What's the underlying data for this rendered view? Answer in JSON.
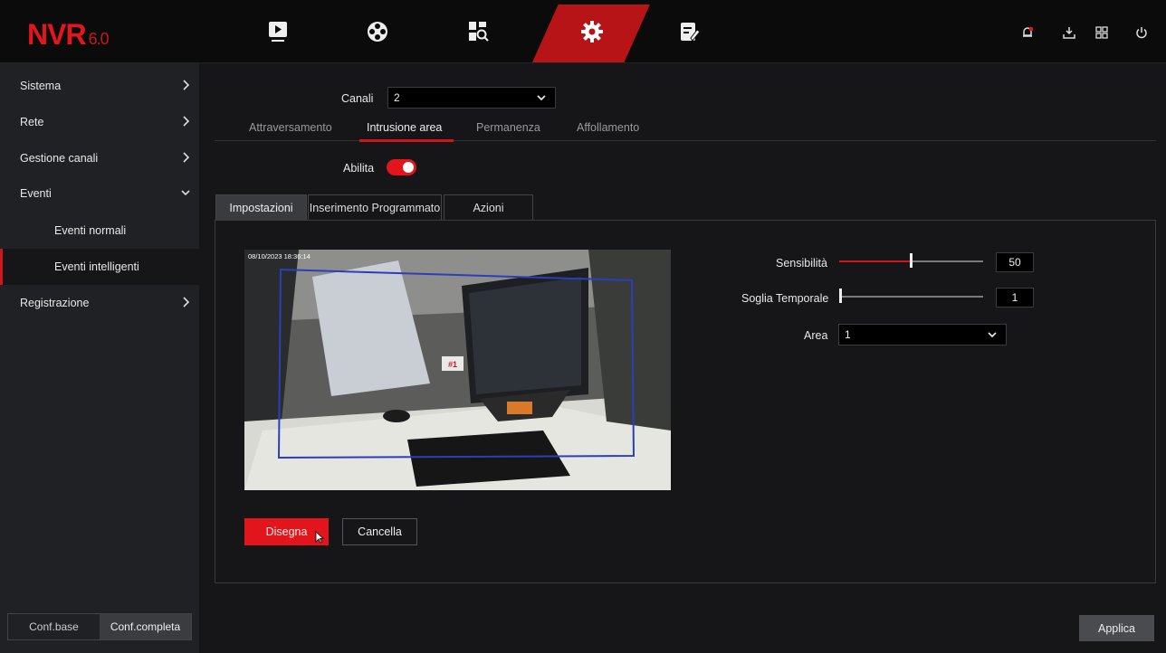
{
  "app": {
    "logo": "NVR",
    "version": "6.0"
  },
  "topnav": [
    {
      "icon": "playback-icon"
    },
    {
      "icon": "reel-icon"
    },
    {
      "icon": "search-file-icon"
    },
    {
      "icon": "gear-icon",
      "active": true
    },
    {
      "icon": "maintenance-icon"
    }
  ],
  "topright": [
    "alarm-icon",
    "download-icon",
    "grid-icon",
    "power-icon"
  ],
  "sidebar": {
    "items": [
      {
        "label": "Sistema"
      },
      {
        "label": "Rete"
      },
      {
        "label": "Gestione canali"
      },
      {
        "label": "Eventi"
      },
      {
        "label": "Eventi normali"
      },
      {
        "label": "Eventi intelligenti"
      },
      {
        "label": "Registrazione"
      }
    ],
    "conf_base": "Conf.base",
    "conf_full": "Conf.completa"
  },
  "channel": {
    "label": "Canali",
    "value": "2"
  },
  "tabs": [
    "Attraversamento",
    "Intrusione area",
    "Permanenza",
    "Affollamento"
  ],
  "enable": {
    "label": "Abilita",
    "value": true
  },
  "subtabs": [
    "Impostazioni",
    "Inserimento Programmato",
    "Azioni"
  ],
  "preview": {
    "timestamp": "08/10/2023 18:36:14",
    "region_label": "#1"
  },
  "settings": {
    "sensitivity": {
      "label": "Sensibilità",
      "value": "50"
    },
    "threshold": {
      "label": "Soglia Temporale",
      "value": "1"
    },
    "area": {
      "label": "Area",
      "value": "1"
    }
  },
  "buttons": {
    "draw": "Disegna",
    "clear": "Cancella",
    "apply": "Applica"
  },
  "colors": {
    "accent": "#d0151b",
    "background": "#161618"
  }
}
